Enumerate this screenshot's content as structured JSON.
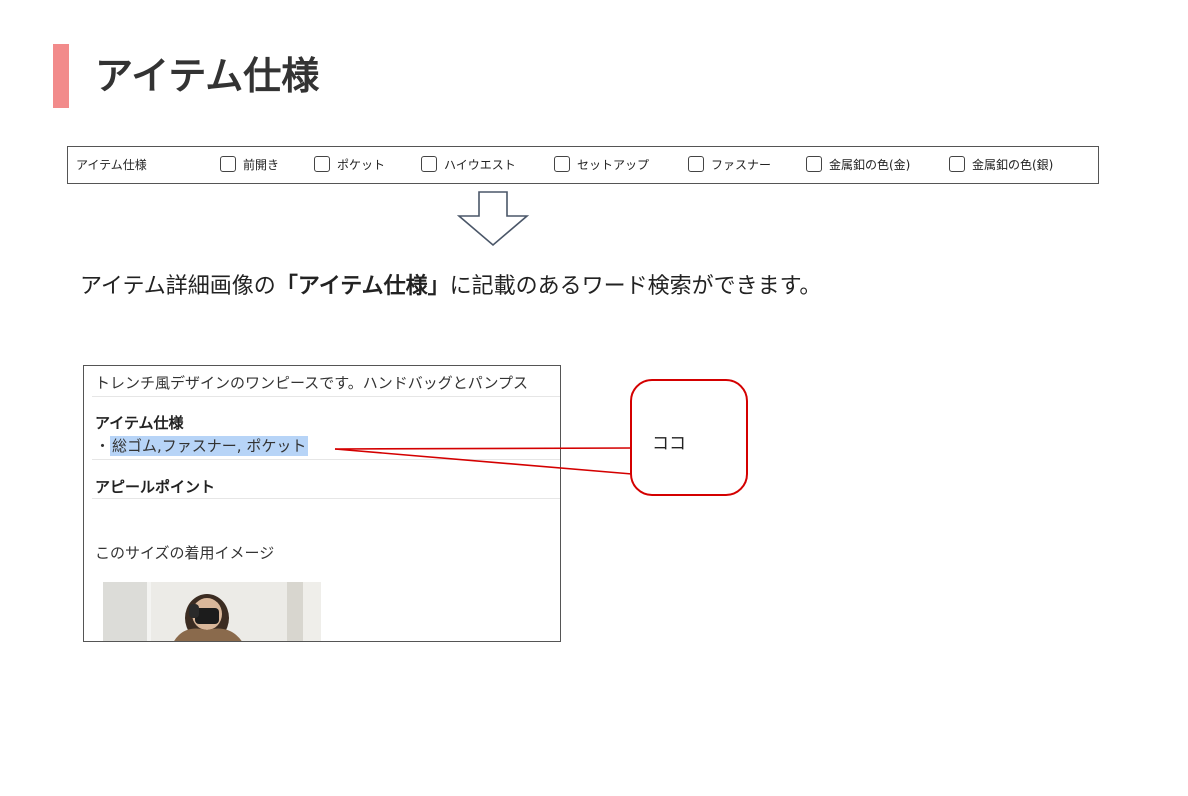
{
  "page": {
    "title": "アイテム仕様"
  },
  "spec_bar": {
    "label": "アイテム仕様",
    "options": [
      {
        "label": "前開き",
        "checked": false
      },
      {
        "label": "ポケット",
        "checked": false
      },
      {
        "label": "ハイウエスト",
        "checked": false
      },
      {
        "label": "セットアップ",
        "checked": false
      },
      {
        "label": "ファスナー",
        "checked": false
      },
      {
        "label": "金属釦の色(金)",
        "checked": false
      },
      {
        "label": "金属釦の色(銀)",
        "checked": false
      }
    ]
  },
  "description": {
    "before": "アイテム詳細画像の",
    "emphasis": "「アイテム仕様」",
    "after": "に記載のあるワード検索ができます。"
  },
  "detail_panel": {
    "intro_text": "トレンチ風デザインのワンピースです。ハンドバッグとパンプス",
    "spec_heading": "アイテム仕様",
    "spec_bullet": "・",
    "spec_value": "総ゴム,ファスナー, ポケット",
    "appeal_heading": "アピールポイント",
    "size_caption": "このサイズの着用イメージ"
  },
  "callout": {
    "text": "ココ"
  },
  "colors": {
    "accent": "#f28b8b",
    "callout_border": "#d40000",
    "highlight": "#b7d4f7"
  }
}
